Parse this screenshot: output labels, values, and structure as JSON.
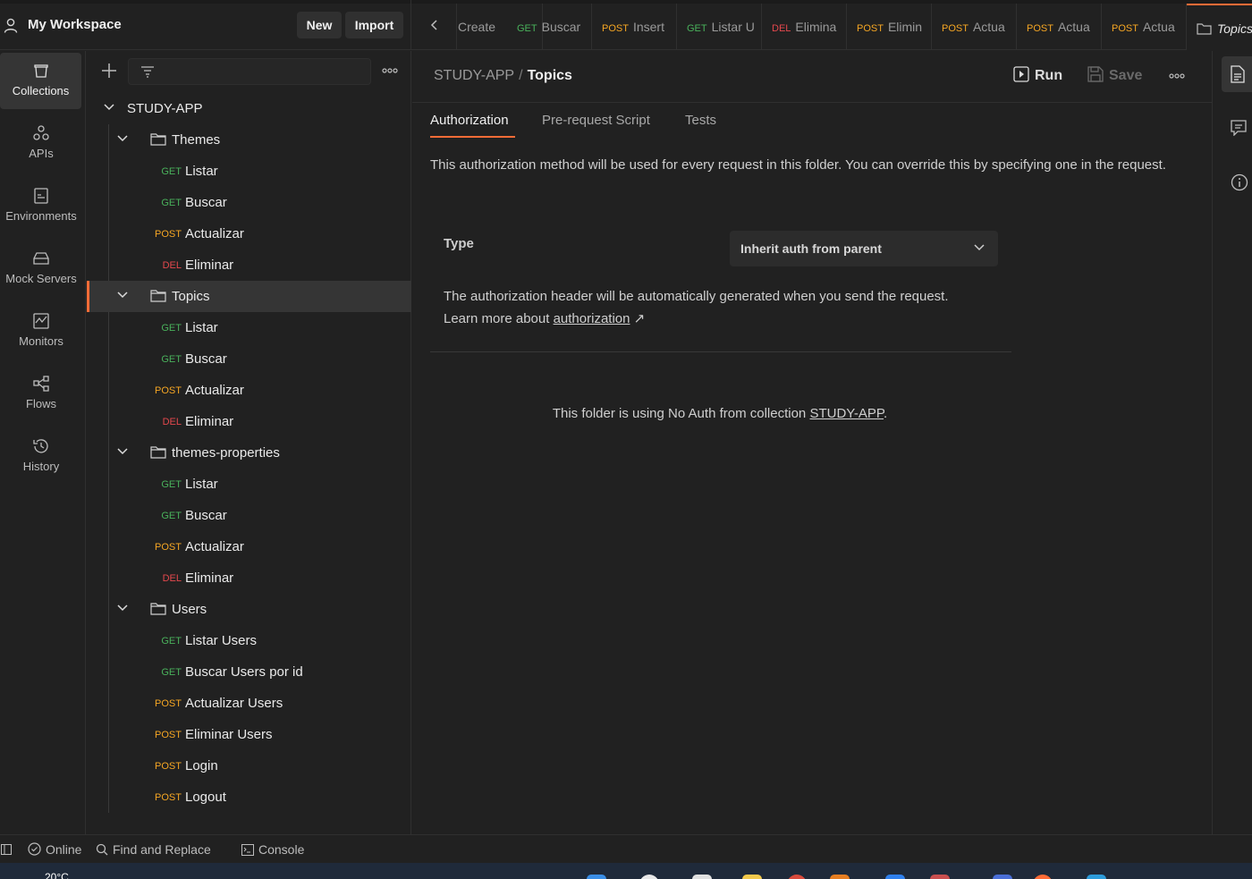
{
  "header": {
    "workspace_title": "My Workspace",
    "new_label": "New",
    "import_label": "Import"
  },
  "tabs": [
    {
      "method": "",
      "title": "Create"
    },
    {
      "method": "GET",
      "title": "Buscar"
    },
    {
      "method": "POST",
      "title": "Insert"
    },
    {
      "method": "GET",
      "title": "Listar U"
    },
    {
      "method": "DEL",
      "title": "Elimina"
    },
    {
      "method": "POST",
      "title": "Elimin"
    },
    {
      "method": "POST",
      "title": "Actua"
    },
    {
      "method": "POST",
      "title": "Actua"
    },
    {
      "method": "POST",
      "title": "Actua"
    },
    {
      "method": "",
      "title": "Topics"
    }
  ],
  "rail": [
    {
      "label": "Collections",
      "icon": "collections-icon"
    },
    {
      "label": "APIs",
      "icon": "apis-icon"
    },
    {
      "label": "Environments",
      "icon": "environments-icon"
    },
    {
      "label": "Mock Servers",
      "icon": "mock-servers-icon"
    },
    {
      "label": "Monitors",
      "icon": "monitors-icon"
    },
    {
      "label": "Flows",
      "icon": "flows-icon"
    },
    {
      "label": "History",
      "icon": "history-icon"
    }
  ],
  "sidebar": {
    "collection": "STUDY-APP",
    "folders": [
      {
        "name": "Themes",
        "requests": [
          {
            "method": "GET",
            "name": "Listar"
          },
          {
            "method": "GET",
            "name": "Buscar"
          },
          {
            "method": "POST",
            "name": "Actualizar"
          },
          {
            "method": "DEL",
            "name": "Eliminar"
          }
        ]
      },
      {
        "name": "Topics",
        "requests": [
          {
            "method": "GET",
            "name": "Listar"
          },
          {
            "method": "GET",
            "name": "Buscar"
          },
          {
            "method": "POST",
            "name": "Actualizar"
          },
          {
            "method": "DEL",
            "name": "Eliminar"
          }
        ]
      },
      {
        "name": "themes-properties",
        "requests": [
          {
            "method": "GET",
            "name": "Listar"
          },
          {
            "method": "GET",
            "name": "Buscar"
          },
          {
            "method": "POST",
            "name": "Actualizar"
          },
          {
            "method": "DEL",
            "name": "Eliminar"
          }
        ]
      },
      {
        "name": "Users",
        "requests": [
          {
            "method": "GET",
            "name": "Listar Users"
          },
          {
            "method": "GET",
            "name": "Buscar Users por id"
          },
          {
            "method": "POST",
            "name": "Actualizar Users"
          },
          {
            "method": "POST",
            "name": "Eliminar Users"
          },
          {
            "method": "POST",
            "name": "Login"
          },
          {
            "method": "POST",
            "name": "Logout"
          }
        ]
      }
    ]
  },
  "main": {
    "breadcrumb_collection": "STUDY-APP",
    "breadcrumb_sep": "/",
    "breadcrumb_current": "Topics",
    "run_label": "Run",
    "save_label": "Save",
    "tabs": [
      "Authorization",
      "Pre-request Script",
      "Tests"
    ],
    "description": "This authorization method will be used for every request in this folder. You can override this by specifying one in the request.",
    "type_label": "Type",
    "type_value": "Inherit auth from parent",
    "auth_note_text": "The authorization header will be automatically generated when you send the request. Learn more about ",
    "auth_note_link": "authorization",
    "auth_note_arrow": "↗",
    "noauth_text": "This folder is using No Auth from collection ",
    "noauth_link": "STUDY-APP",
    "noauth_end": "."
  },
  "status": {
    "online": "Online",
    "find_replace": "Find and Replace",
    "console": "Console"
  },
  "taskbar": {
    "temperature": "20°C"
  },
  "colors": {
    "accent": "#ff6c37",
    "get": "#49b15b",
    "post": "#f5a623",
    "del": "#e5484d"
  }
}
